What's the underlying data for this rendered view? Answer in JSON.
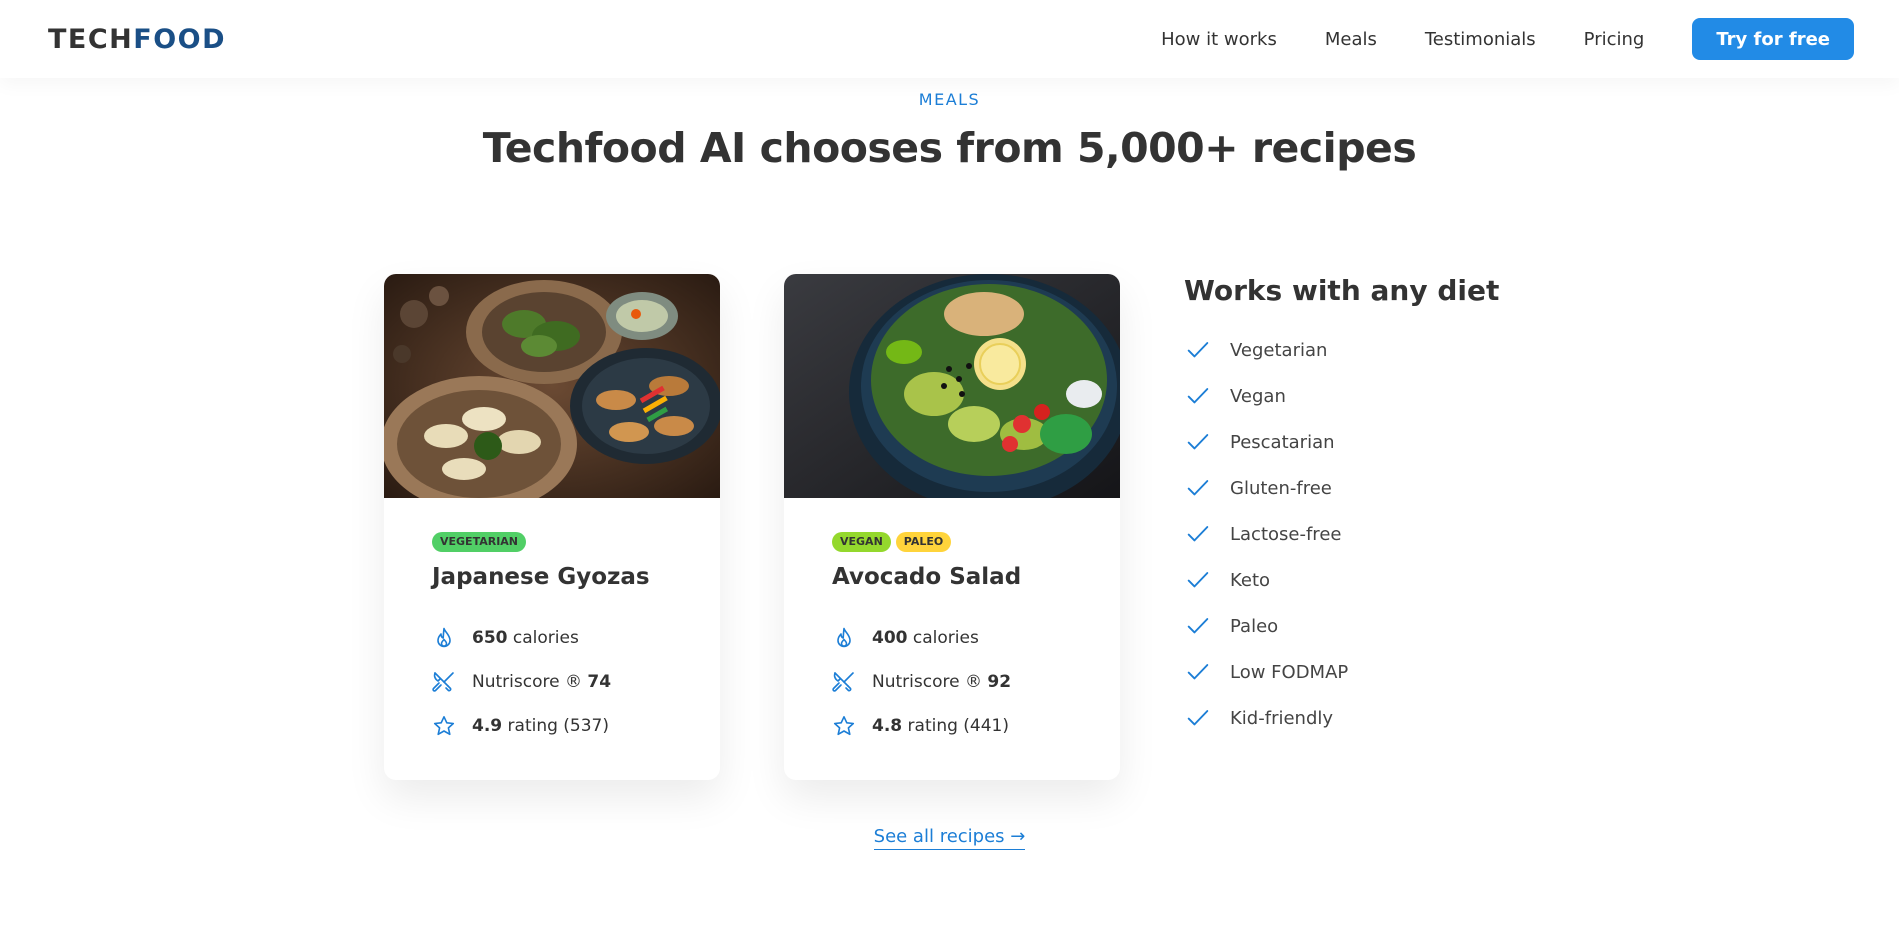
{
  "header": {
    "logo_part1": "TECH",
    "logo_part2": "FOOD",
    "nav": [
      "How it works",
      "Meals",
      "Testimonials",
      "Pricing"
    ],
    "cta_label": "Try for free"
  },
  "section": {
    "eyebrow": "MEALS",
    "title": "Techfood AI chooses from 5,000+ recipes"
  },
  "meals": [
    {
      "tags": [
        {
          "label": "Vegetarian",
          "color": "#51cf66"
        }
      ],
      "title": "Japanese Gyozas",
      "calories_value": "650",
      "calories_label": "calories",
      "nutriscore_label": "Nutriscore ®",
      "nutriscore_value": "74",
      "rating_value": "4.9",
      "rating_label": "rating (537)"
    },
    {
      "tags": [
        {
          "label": "Vegan",
          "color": "#94d82d"
        },
        {
          "label": "Paleo",
          "color": "#ffd43b"
        }
      ],
      "title": "Avocado Salad",
      "calories_value": "400",
      "calories_label": "calories",
      "nutriscore_label": "Nutriscore ®",
      "nutriscore_value": "92",
      "rating_value": "4.8",
      "rating_label": "rating (441)"
    }
  ],
  "diets": {
    "title": "Works with any diet",
    "items": [
      "Vegetarian",
      "Vegan",
      "Pescatarian",
      "Gluten-free",
      "Lactose-free",
      "Keto",
      "Paleo",
      "Low FODMAP",
      "Kid-friendly"
    ]
  },
  "see_all": "See all recipes →",
  "icons": {
    "calories": "flame-icon",
    "nutriscore": "utensils-icon",
    "rating": "star-icon",
    "diet_check": "checkmark-icon"
  },
  "colors": {
    "accent": "#228be6",
    "link": "#1c7ed6",
    "logo_accent": "#1a4f86",
    "text": "#333333"
  }
}
